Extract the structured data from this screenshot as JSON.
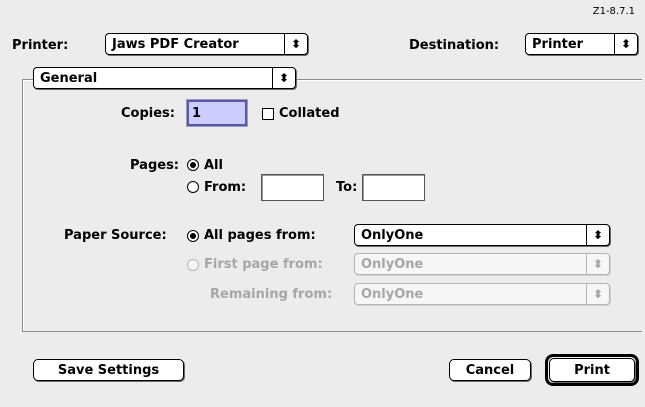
{
  "version": "Z1-8.7.1",
  "printer": {
    "label": "Printer:",
    "value": "Jaws PDF Creator"
  },
  "destination": {
    "label": "Destination:",
    "value": "Printer"
  },
  "panel": {
    "value": "General"
  },
  "copies": {
    "label": "Copies:",
    "value": "1",
    "collated_label": "Collated",
    "collated": false
  },
  "pages": {
    "label": "Pages:",
    "all_label": "All",
    "from_label": "From:",
    "to_label": "To:",
    "from_value": "",
    "to_value": "",
    "selected": "All"
  },
  "paper_source": {
    "label": "Paper Source:",
    "all_pages_label": "All pages from:",
    "all_pages_value": "OnlyOne",
    "first_page_label": "First page from:",
    "first_page_value": "OnlyOne",
    "remaining_label": "Remaining from:",
    "remaining_value": "OnlyOne",
    "selected": "All pages from:"
  },
  "buttons": {
    "save": "Save Settings",
    "cancel": "Cancel",
    "print": "Print"
  },
  "arrow_glyph": "⬍"
}
